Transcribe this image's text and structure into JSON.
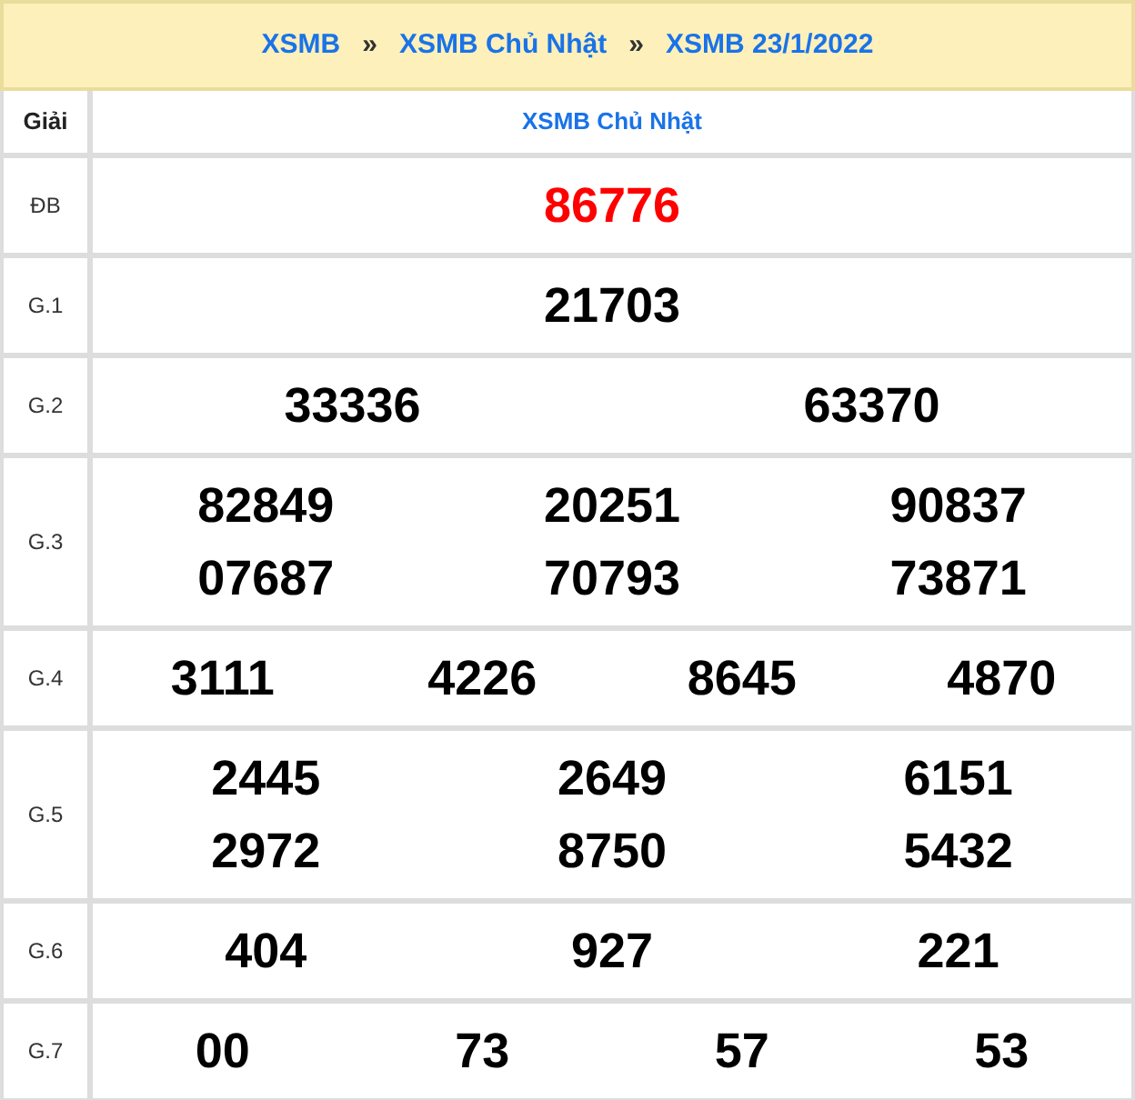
{
  "breadcrumb": [
    "XSMB",
    "XSMB Chủ Nhật",
    "XSMB 23/1/2022"
  ],
  "breadcrumb_separator": "»",
  "table": {
    "label_header": "Giải",
    "title": "XSMB Chủ Nhật",
    "prizes": [
      {
        "label": "ĐB",
        "highlight": true,
        "lines": [
          [
            "86776"
          ]
        ]
      },
      {
        "label": "G.1",
        "highlight": false,
        "lines": [
          [
            "21703"
          ]
        ]
      },
      {
        "label": "G.2",
        "highlight": false,
        "lines": [
          [
            "33336",
            "63370"
          ]
        ]
      },
      {
        "label": "G.3",
        "highlight": false,
        "lines": [
          [
            "82849",
            "20251",
            "90837"
          ],
          [
            "07687",
            "70793",
            "73871"
          ]
        ]
      },
      {
        "label": "G.4",
        "highlight": false,
        "lines": [
          [
            "3111",
            "4226",
            "8645",
            "4870"
          ]
        ]
      },
      {
        "label": "G.5",
        "highlight": false,
        "lines": [
          [
            "2445",
            "2649",
            "6151"
          ],
          [
            "2972",
            "8750",
            "5432"
          ]
        ]
      },
      {
        "label": "G.6",
        "highlight": false,
        "lines": [
          [
            "404",
            "927",
            "221"
          ]
        ]
      },
      {
        "label": "G.7",
        "highlight": false,
        "lines": [
          [
            "00",
            "73",
            "57",
            "53"
          ]
        ]
      }
    ]
  }
}
